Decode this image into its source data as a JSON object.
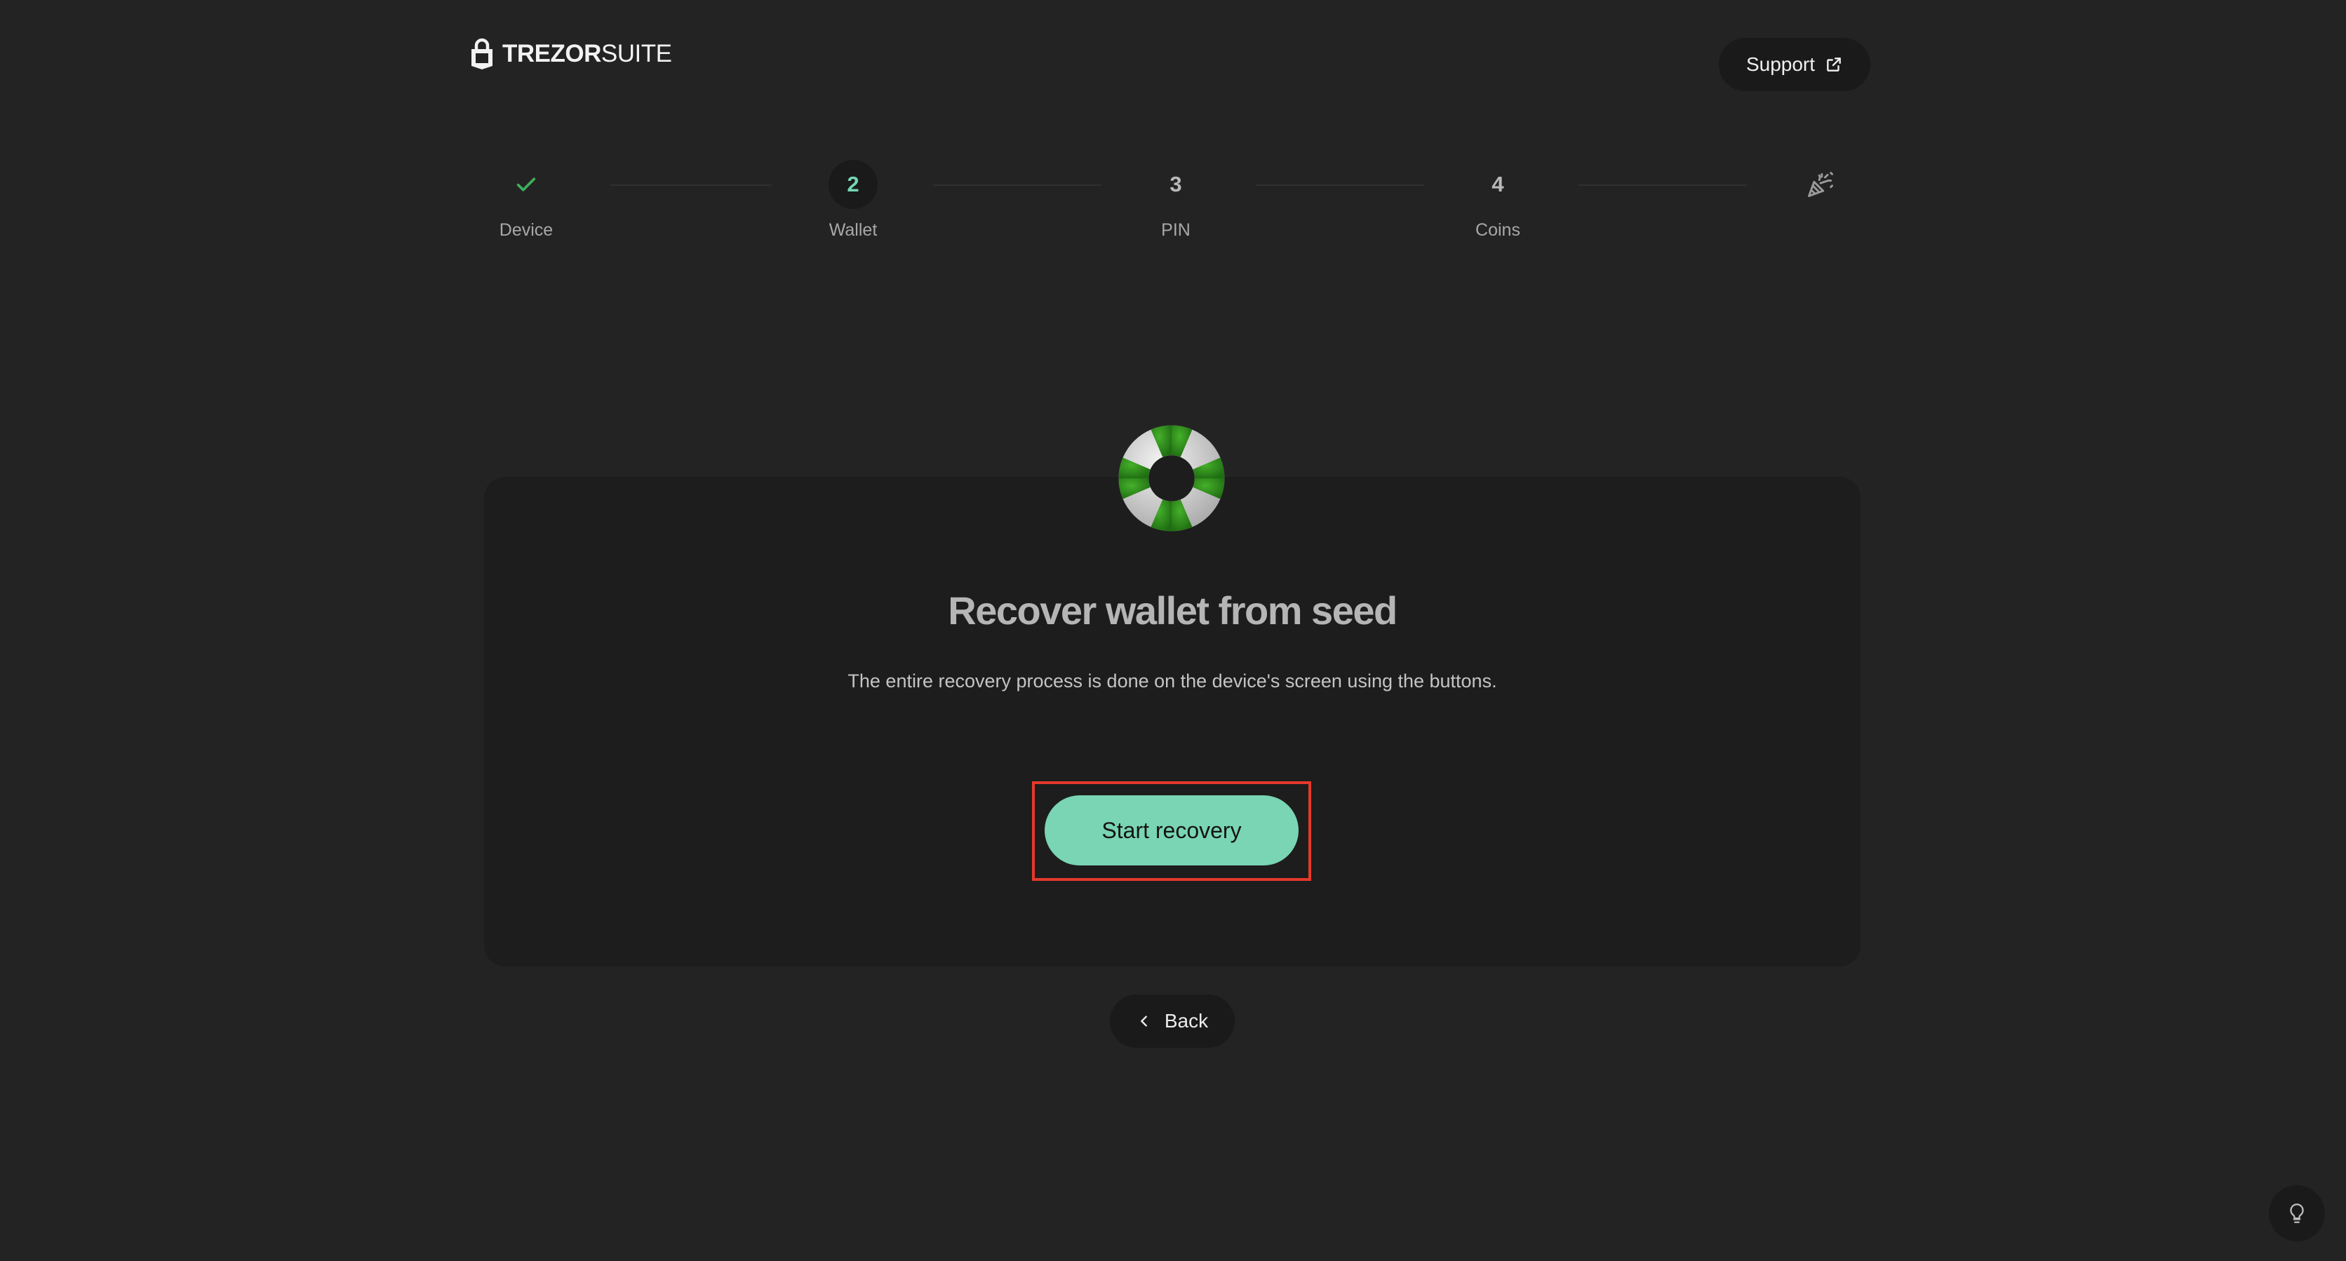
{
  "header": {
    "logo_bold": "TREZOR",
    "logo_light": "SUITE",
    "support_label": "Support"
  },
  "stepper": {
    "steps": [
      {
        "marker": "",
        "label": "Device",
        "state": "done"
      },
      {
        "marker": "2",
        "label": "Wallet",
        "state": "active"
      },
      {
        "marker": "3",
        "label": "PIN",
        "state": "pending"
      },
      {
        "marker": "4",
        "label": "Coins",
        "state": "pending"
      },
      {
        "marker": "",
        "label": "",
        "state": "final"
      }
    ]
  },
  "card": {
    "title": "Recover wallet from seed",
    "description": "The entire recovery process is done on the device's screen using the buttons.",
    "primary_button": "Start recovery"
  },
  "footer": {
    "back_label": "Back"
  },
  "colors": {
    "background": "#232323",
    "card": "#1d1d1d",
    "accent": "#79d5b3",
    "check": "#3fae5a",
    "highlight": "#e5392b"
  },
  "icons": [
    "lock-logo-icon",
    "external-link-icon",
    "checkmark-icon",
    "party-popper-icon",
    "lifebuoy-icon",
    "chevron-left-icon",
    "lightbulb-icon"
  ]
}
